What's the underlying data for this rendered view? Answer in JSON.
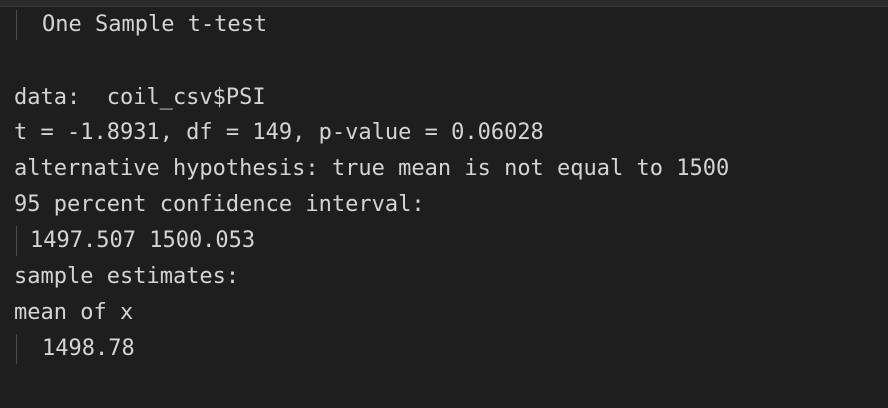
{
  "output": {
    "title": "One Sample t-test",
    "data_line": "data:  coil_csv$PSI",
    "stats_line": "t = -1.8931, df = 149, p-value = 0.06028",
    "alt_line": "alternative hypothesis: true mean is not equal to 1500",
    "ci_header": "95 percent confidence interval:",
    "ci_values": "1497.507 1500.053",
    "estimates_header": "sample estimates:",
    "mean_label": "mean of x",
    "mean_value": "1498.78"
  }
}
